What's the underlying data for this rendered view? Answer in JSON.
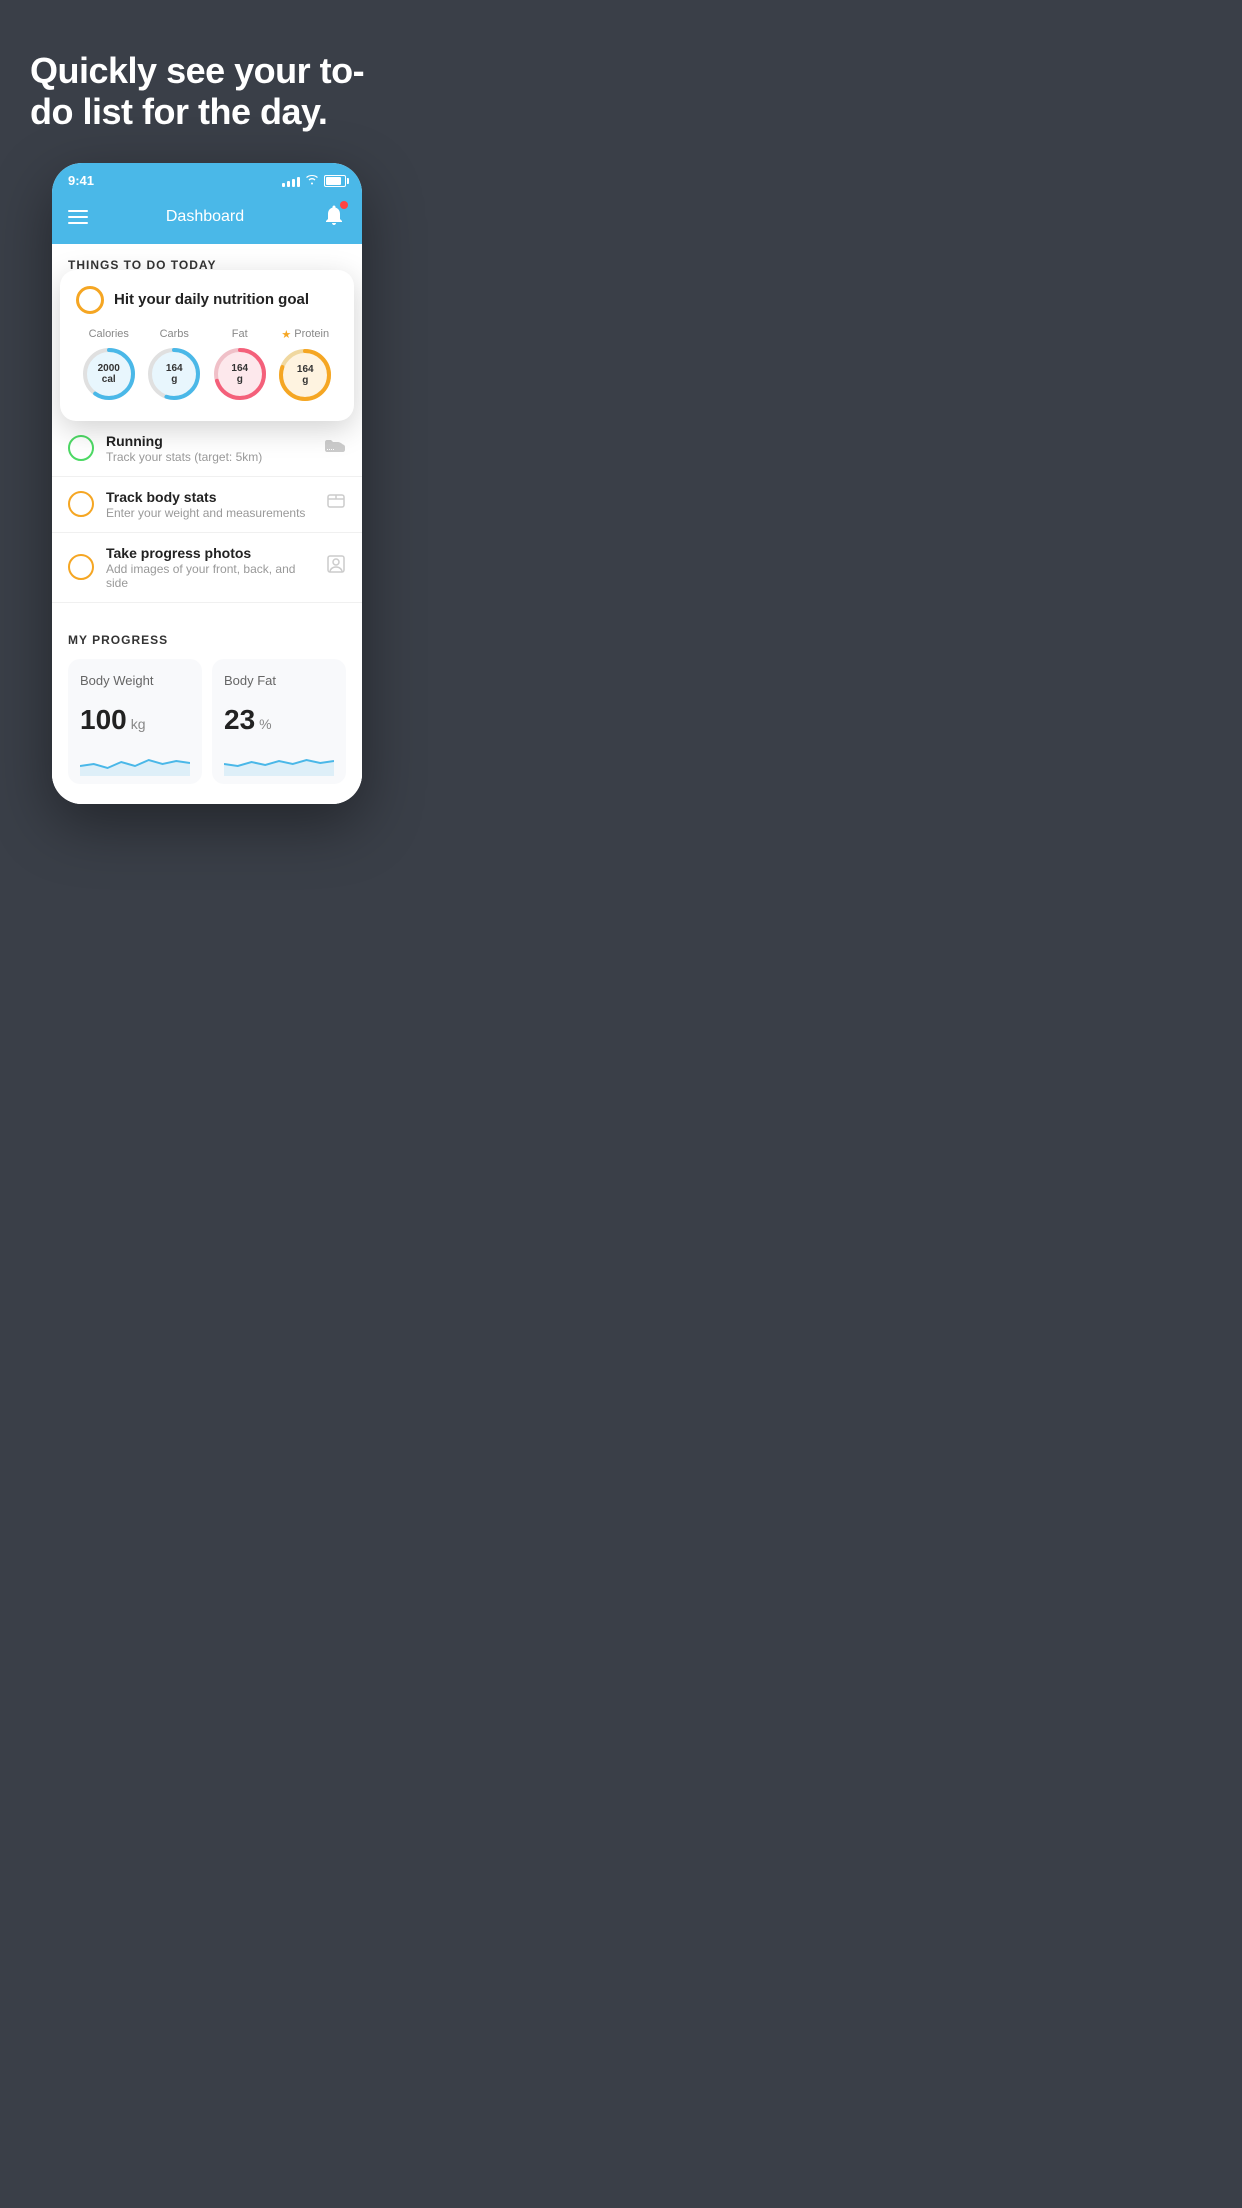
{
  "hero": {
    "title": "Quickly see your to-do list for the day."
  },
  "status_bar": {
    "time": "9:41"
  },
  "header": {
    "title": "Dashboard"
  },
  "things_section": {
    "label": "THINGS TO DO TODAY"
  },
  "floating_card": {
    "circle_color": "#f5a623",
    "title": "Hit your daily nutrition goal",
    "nutrition": [
      {
        "label": "Calories",
        "value": "2000",
        "unit": "cal",
        "color": "#4ab8e8",
        "bg": "#e8f6fd",
        "percent": 60
      },
      {
        "label": "Carbs",
        "value": "164",
        "unit": "g",
        "color": "#4ab8e8",
        "bg": "#e8f6fd",
        "percent": 55
      },
      {
        "label": "Fat",
        "value": "164",
        "unit": "g",
        "color": "#f4607a",
        "bg": "#fde8ec",
        "percent": 70
      },
      {
        "label": "Protein",
        "value": "164",
        "unit": "g",
        "color": "#f5a623",
        "bg": "#fef3e0",
        "percent": 80,
        "starred": true
      }
    ]
  },
  "todo_items": [
    {
      "circle_color": "green",
      "title": "Running",
      "subtitle": "Track your stats (target: 5km)",
      "icon": "shoe"
    },
    {
      "circle_color": "yellow",
      "title": "Track body stats",
      "subtitle": "Enter your weight and measurements",
      "icon": "scale"
    },
    {
      "circle_color": "yellow",
      "title": "Take progress photos",
      "subtitle": "Add images of your front, back, and side",
      "icon": "person"
    }
  ],
  "progress_section": {
    "label": "MY PROGRESS",
    "cards": [
      {
        "title": "Body Weight",
        "value": "100",
        "unit": "kg"
      },
      {
        "title": "Body Fat",
        "value": "23",
        "unit": "%"
      }
    ]
  }
}
